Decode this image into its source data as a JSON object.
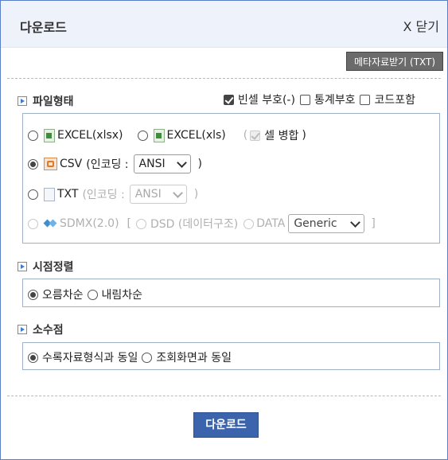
{
  "dialog": {
    "title": "다운로드",
    "close_label": "X 닫기",
    "meta_button": "메타자료받기 (TXT)"
  },
  "file_type": {
    "heading": "파일형태",
    "options": {
      "blank_symbol": "빈셀 부호(-)",
      "stat_symbol": "통계부호",
      "include_code": "코드포함"
    },
    "excel_xlsx": "EXCEL(xlsx)",
    "excel_xls": "EXCEL(xls)",
    "merge_open": "(",
    "merge_label": "셀 병합",
    "merge_close": ")",
    "csv": "CSV",
    "csv_encoding_open": "(인코딩 :",
    "csv_encoding_value": "ANSI",
    "csv_encoding_close": ")",
    "txt": "TXT",
    "txt_encoding_open": "(인코딩 :",
    "txt_encoding_value": "ANSI",
    "txt_encoding_close": ")",
    "sdmx": "SDMX(2.0)",
    "sdmx_bracket_open": "[",
    "dsd": "DSD (데이터구조)",
    "data": "DATA",
    "data_select_value": "Generic",
    "sdmx_bracket_close": "]"
  },
  "sort": {
    "heading": "시점정렬",
    "asc": "오름차순",
    "desc": "내림차순"
  },
  "decimal": {
    "heading": "소수점",
    "same_as_source": "수록자료형식과 동일",
    "same_as_view": "조회화면과 동일"
  },
  "download_button": "다운로드",
  "colors": {
    "accent": "#3b64ad",
    "titlebar": "#eef2fb",
    "border": "#5a7fc6"
  }
}
